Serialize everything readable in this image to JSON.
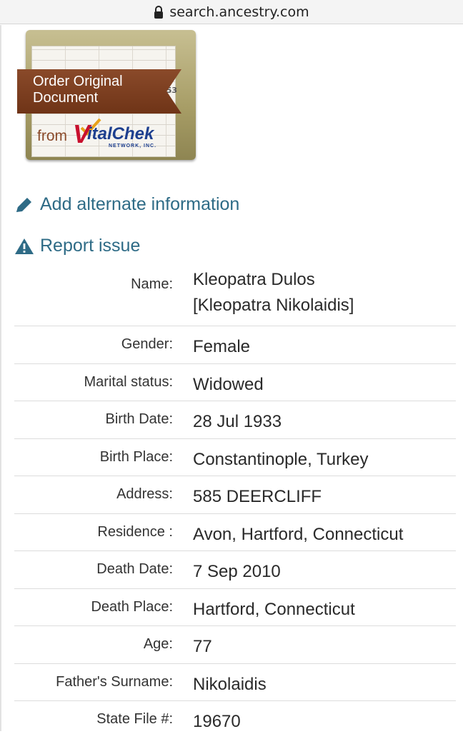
{
  "browser": {
    "url": "search.ancestry.com"
  },
  "vitalchek": {
    "banner_line1": "Order Original",
    "banner_line2": "Document",
    "from": "from",
    "brand_v": "V",
    "brand_rest": "italChek",
    "brand_sub": "NETWORK, INC.",
    "doc_number": "53"
  },
  "actions": {
    "add_alternate": "Add alternate information",
    "report_issue": "Report issue"
  },
  "record": [
    {
      "label": "Name:",
      "value": "Kleopatra Dulos",
      "value2": "[Kleopatra Nikolaidis]"
    },
    {
      "label": "Gender:",
      "value": "Female"
    },
    {
      "label": "Marital status:",
      "value": "Widowed"
    },
    {
      "label": "Birth Date:",
      "value": "28 Jul 1933"
    },
    {
      "label": "Birth Place:",
      "value": "Constantinople, Turkey"
    },
    {
      "label": "Address:",
      "value": "585 DEERCLIFF"
    },
    {
      "label": "Residence :",
      "value": "Avon, Hartford, Connecticut"
    },
    {
      "label": "Death Date:",
      "value": "7 Sep 2010"
    },
    {
      "label": "Death Place:",
      "value": "Hartford, Connecticut"
    },
    {
      "label": "Age:",
      "value": "77"
    },
    {
      "label": "Father's Surname:",
      "value": "Nikolaidis"
    },
    {
      "label": "State File #:",
      "value": "19670"
    }
  ]
}
